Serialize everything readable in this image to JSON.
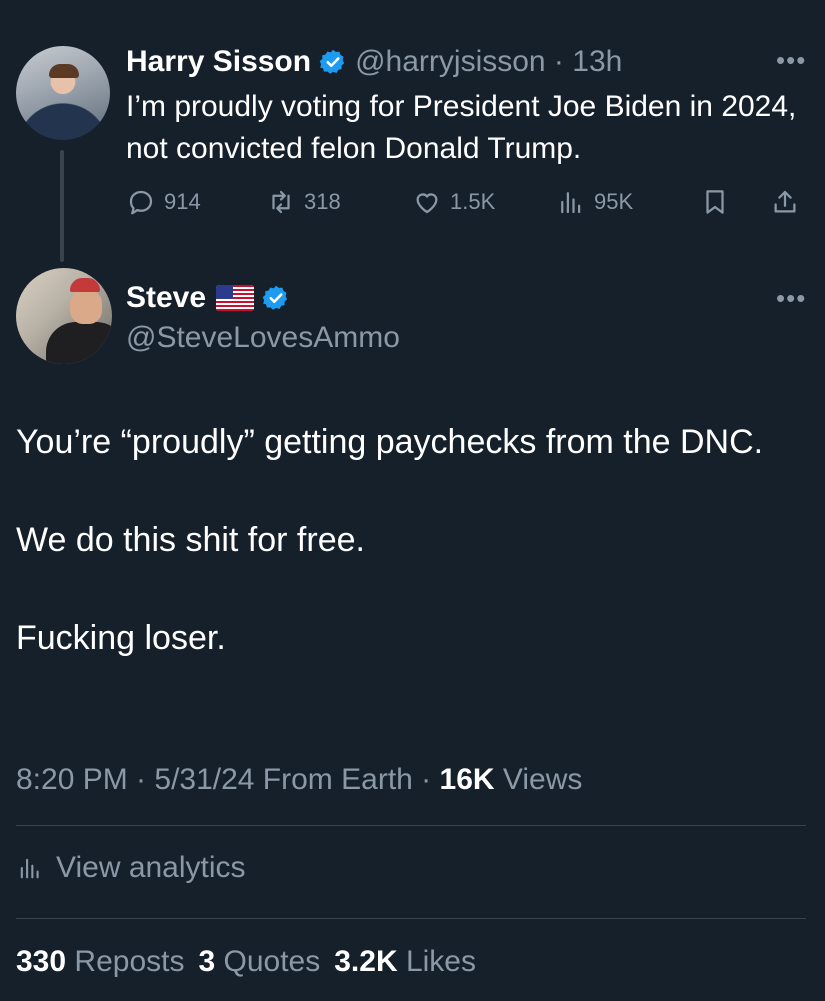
{
  "parent_tweet": {
    "author_name": "Harry Sisson",
    "handle_time": "@harryjsisson · 13h",
    "text": "I’m proudly voting for President Joe Biden in 2024, not convicted felon Donald Trump.",
    "replies": "914",
    "reposts": "318",
    "likes": "1.5K",
    "views": "95K"
  },
  "main_tweet": {
    "author_name": "Steve",
    "handle": "@SteveLovesAmmo",
    "paragraphs": [
      "You’re “proudly” getting paychecks from the DNC.",
      "We do this shit for free.",
      "Fucking loser."
    ],
    "meta_prefix": "8:20 PM · 5/31/24 From Earth · ",
    "views_count": "16K",
    "views_label": "Views",
    "view_analytics": "View analytics",
    "reposts_count": "330",
    "reposts_label": "Reposts",
    "quotes_count": "3",
    "quotes_label": "Quotes",
    "likes_count": "3.2K",
    "likes_label": "Likes"
  },
  "more_glyph": "•••",
  "colors": {
    "background": "#15202b",
    "muted_text": "#8b98a5",
    "verified_blue": "#1d9bf0",
    "divider": "#38444d"
  },
  "icons": [
    "verified-badge-icon",
    "more-icon",
    "reply-icon",
    "repost-icon",
    "like-icon",
    "views-icon",
    "bookmark-icon",
    "share-icon",
    "us-flag-icon",
    "analytics-icon"
  ]
}
